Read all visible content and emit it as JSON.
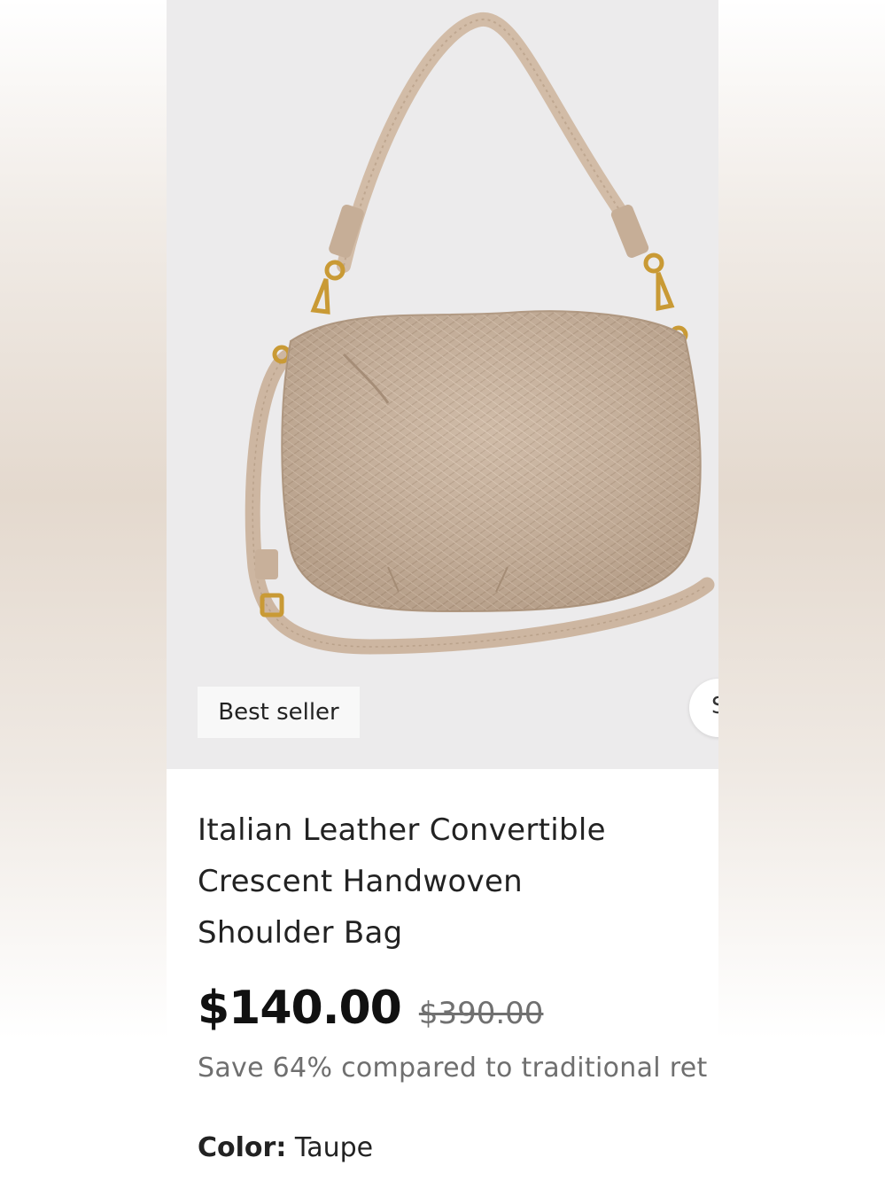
{
  "product": {
    "badge": "Best seller",
    "next_button_glyph": "S",
    "title_lines": [
      "Italian Leather Convertible",
      "Crescent Handwoven",
      "Shoulder Bag"
    ],
    "price": "$140.00",
    "original_price": "$390.00",
    "savings_text": "Save 64% compared to traditional ret",
    "color_label": "Color:",
    "color_value": "Taupe"
  },
  "colors": {
    "bag": "#c9b29c",
    "image_bg": "#ecebec",
    "hardware": "#c99a35"
  }
}
